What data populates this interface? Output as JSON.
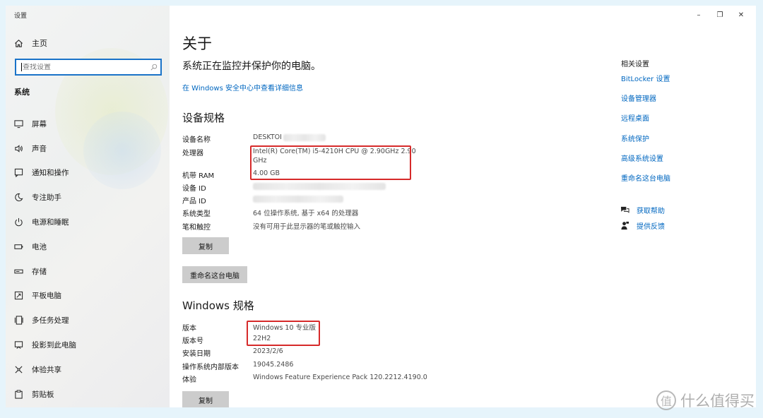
{
  "window": {
    "title": "设置",
    "minimize": "–",
    "maximize": "❐",
    "close": "✕"
  },
  "sidebar": {
    "home_label": "主页",
    "search_placeholder": "查找设置",
    "section": "系统",
    "items": [
      {
        "label": "屏幕",
        "icon": "monitor-icon"
      },
      {
        "label": "声音",
        "icon": "speaker-icon"
      },
      {
        "label": "通知和操作",
        "icon": "notification-icon"
      },
      {
        "label": "专注助手",
        "icon": "moon-icon"
      },
      {
        "label": "电源和睡眠",
        "icon": "power-icon"
      },
      {
        "label": "电池",
        "icon": "battery-icon"
      },
      {
        "label": "存储",
        "icon": "storage-icon"
      },
      {
        "label": "平板电脑",
        "icon": "tablet-icon"
      },
      {
        "label": "多任务处理",
        "icon": "multitask-icon"
      },
      {
        "label": "投影到此电脑",
        "icon": "project-icon"
      },
      {
        "label": "体验共享",
        "icon": "share-icon"
      },
      {
        "label": "剪贴板",
        "icon": "clipboard-icon"
      }
    ]
  },
  "main": {
    "title": "关于",
    "status": "系统正在监控并保护你的电脑。",
    "security_link": "在 Windows 安全中心中查看详细信息",
    "device_heading": "设备规格",
    "device_specs": {
      "name_label": "设备名称",
      "name_value": "DESKTOI",
      "cpu_label": "处理器",
      "cpu_value_1": "Intel(R) Core(TM) i5-4210H CPU @ 2.90GHz   2.90",
      "cpu_value_2": "GHz",
      "ram_label": "机带 RAM",
      "ram_value": "4.00 GB",
      "device_id_label": "设备 ID",
      "product_id_label": "产品 ID",
      "system_type_label": "系统类型",
      "system_type_value": "64 位操作系统, 基于 x64 的处理器",
      "pen_label": "笔和触控",
      "pen_value": "没有可用于此显示器的笔或触控输入"
    },
    "copy_button": "复制",
    "rename_button": "重命名这台电脑",
    "windows_heading": "Windows 规格",
    "windows_specs": {
      "edition_label": "版本",
      "edition_value": "Windows 10 专业版",
      "version_label": "版本号",
      "version_value": "22H2",
      "install_label": "安装日期",
      "install_value": "2023/2/6",
      "build_label": "操作系统内部版本",
      "build_value": "19045.2486",
      "experience_label": "体验",
      "experience_value": "Windows Feature Experience Pack 120.2212.4190.0"
    },
    "copy_button_2": "复制"
  },
  "related": {
    "heading": "相关设置",
    "links": [
      "BitLocker 设置",
      "设备管理器",
      "远程桌面",
      "系统保护",
      "高级系统设置",
      "重命名这台电脑"
    ],
    "get_help": "获取帮助",
    "feedback": "提供反馈"
  },
  "watermark": {
    "text": "什么值得买",
    "mark": "值"
  },
  "colors": {
    "accent": "#0067c0",
    "highlight": "#d62a2a",
    "button": "#cccccc",
    "search_border": "#1a73c8"
  }
}
